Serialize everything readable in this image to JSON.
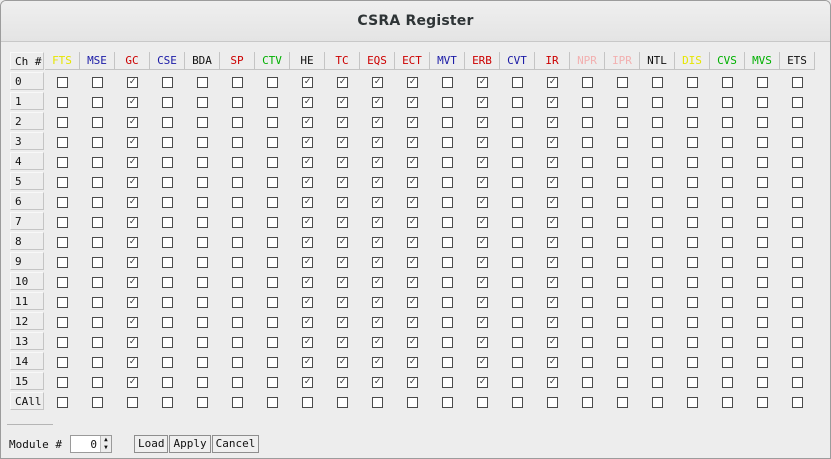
{
  "window": {
    "title": "CSRA Register"
  },
  "table": {
    "corner_label": "Ch #",
    "columns": [
      {
        "label": "FTS",
        "color": "#e6e600"
      },
      {
        "label": "MSE",
        "color": "#1a1aa6"
      },
      {
        "label": "GC",
        "color": "#cc0000"
      },
      {
        "label": "CSE",
        "color": "#1a1aa6"
      },
      {
        "label": "BDA",
        "color": "#111111"
      },
      {
        "label": "SP",
        "color": "#cc0000"
      },
      {
        "label": "CTV",
        "color": "#00b000"
      },
      {
        "label": "HE",
        "color": "#111111"
      },
      {
        "label": "TC",
        "color": "#cc0000"
      },
      {
        "label": "EQS",
        "color": "#cc0000"
      },
      {
        "label": "ECT",
        "color": "#cc0000"
      },
      {
        "label": "MVT",
        "color": "#1a1aa6"
      },
      {
        "label": "ERB",
        "color": "#cc0000"
      },
      {
        "label": "CVT",
        "color": "#1a1aa6"
      },
      {
        "label": "IR",
        "color": "#cc0000"
      },
      {
        "label": "NPR",
        "color": "#f2b0b0"
      },
      {
        "label": "IPR",
        "color": "#f2b0b0"
      },
      {
        "label": "NTL",
        "color": "#111111"
      },
      {
        "label": "DIS",
        "color": "#e6e600"
      },
      {
        "label": "CVS",
        "color": "#00b000"
      },
      {
        "label": "MVS",
        "color": "#00b000"
      },
      {
        "label": "ETS",
        "color": "#111111"
      }
    ],
    "rows": [
      "0",
      "1",
      "2",
      "3",
      "4",
      "5",
      "6",
      "7",
      "8",
      "9",
      "10",
      "11",
      "12",
      "13",
      "14",
      "15",
      "CAll"
    ],
    "checked_columns_per_channel_row": [
      "GC",
      "HE",
      "TC",
      "EQS",
      "ECT",
      "ERB",
      "IR"
    ],
    "call_row_checked": []
  },
  "controls": {
    "module_label": "Module #",
    "module_value": "0",
    "load_label": "Load",
    "apply_label": "Apply",
    "cancel_label": "Cancel"
  }
}
